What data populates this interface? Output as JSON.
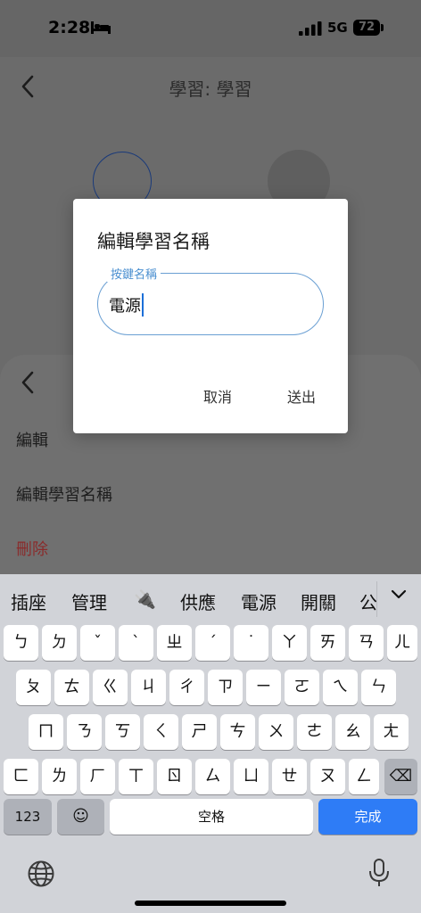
{
  "status": {
    "time": "2:28",
    "network": "5G",
    "battery": "72"
  },
  "page": {
    "title": "學習: 學習"
  },
  "sheet": {
    "items": [
      "編輯",
      "編輯學習名稱",
      "刪除"
    ]
  },
  "dialog": {
    "title": "編輯學習名稱",
    "field_label": "按鍵名稱",
    "field_value": "電源",
    "cancel": "取消",
    "submit": "送出"
  },
  "keyboard": {
    "suggestions": [
      "插座",
      "管理",
      "🔌",
      "供應",
      "電源",
      "開關",
      "公"
    ],
    "rows": [
      [
        "ㄅ",
        "ㄉ",
        "ˇ",
        "ˋ",
        "ㄓ",
        "ˊ",
        "˙",
        "ㄚ",
        "ㄞ",
        "ㄢ",
        "ㄦ"
      ],
      [
        "ㄆ",
        "ㄊ",
        "ㄍ",
        "ㄐ",
        "ㄔ",
        "ㄗ",
        "ㄧ",
        "ㄛ",
        "ㄟ",
        "ㄣ"
      ],
      [
        "ㄇ",
        "ㄋ",
        "ㄎ",
        "ㄑ",
        "ㄕ",
        "ㄘ",
        "ㄨ",
        "ㄜ",
        "ㄠ",
        "ㄤ"
      ],
      [
        "ㄈ",
        "ㄌ",
        "ㄏ",
        "ㄒ",
        "ㄖ",
        "ㄙ",
        "ㄩ",
        "ㄝ",
        "ㄡ",
        "ㄥ"
      ]
    ],
    "numbers_key": "123",
    "emoji_key": "☺",
    "space_key": "空格",
    "done_key": "完成",
    "delete_key": "⌫"
  }
}
